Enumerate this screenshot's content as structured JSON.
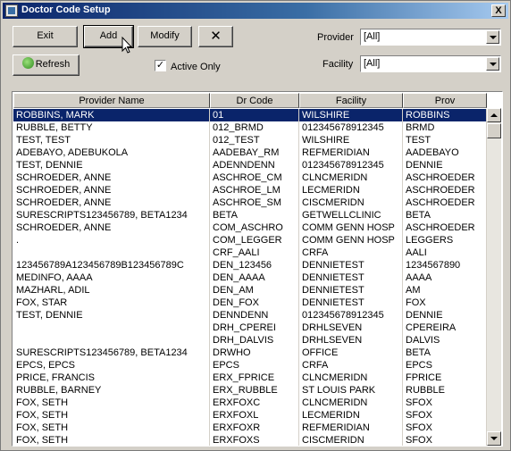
{
  "window": {
    "title": "Doctor Code Setup",
    "close_glyph": "X"
  },
  "toolbar": {
    "exit_label": "Exit",
    "add_label": "Add",
    "modify_label": "Modify",
    "delete_glyph": "✕",
    "refresh_label": "Refresh",
    "active_only_label": "Active Only",
    "active_only_checked": "✓"
  },
  "filters": {
    "provider_label": "Provider",
    "provider_value": "[All]",
    "facility_label": "Facility",
    "facility_value": "[All]"
  },
  "grid": {
    "columns": [
      "Provider Name",
      "Dr Code",
      "Facility",
      "Prov"
    ],
    "selected_row": 0,
    "rows": [
      [
        "ROBBINS, MARK",
        "01",
        "WILSHIRE",
        "ROBBINS"
      ],
      [
        "RUBBLE, BETTY",
        "012_BRMD",
        "012345678912345",
        "BRMD"
      ],
      [
        "TEST, TEST",
        "012_TEST",
        "WILSHIRE",
        "TEST"
      ],
      [
        "ADEBAYO, ADEBUKOLA",
        "AADEBAY_RM",
        "REFMERIDIAN",
        "AADEBAYO"
      ],
      [
        "TEST, DENNIE",
        "ADENNDENN",
        "012345678912345",
        "DENNIE"
      ],
      [
        "SCHROEDER, ANNE",
        "ASCHROE_CM",
        "CLNCMERIDN",
        "ASCHROEDER"
      ],
      [
        "SCHROEDER, ANNE",
        "ASCHROE_LM",
        "LECMERIDN",
        "ASCHROEDER"
      ],
      [
        "SCHROEDER, ANNE",
        "ASCHROE_SM",
        "CISCMERIDN",
        "ASCHROEDER"
      ],
      [
        "SURESCRIPTS123456789, BETA1234",
        "BETA",
        "GETWELLCLINIC",
        "BETA"
      ],
      [
        "SCHROEDER, ANNE",
        "COM_ASCHRO",
        "COMM GENN HOSP",
        "ASCHROEDER"
      ],
      [
        ".",
        "COM_LEGGER",
        "COMM GENN HOSP",
        "LEGGERS"
      ],
      [
        "",
        "CRF_AALI",
        "CRFA",
        "AALI"
      ],
      [
        "123456789A123456789B123456789C",
        "DEN_123456",
        "DENNIETEST",
        "1234567890"
      ],
      [
        "MEDINFO, AAAA",
        "DEN_AAAA",
        "DENNIETEST",
        "AAAA"
      ],
      [
        "MAZHARL, ADIL",
        "DEN_AM",
        "DENNIETEST",
        "AM"
      ],
      [
        "FOX, STAR",
        "DEN_FOX",
        "DENNIETEST",
        "FOX"
      ],
      [
        "TEST, DENNIE",
        "DENNDENN",
        "012345678912345",
        "DENNIE"
      ],
      [
        "",
        "DRH_CPEREI",
        "DRHLSEVEN",
        "CPEREIRA"
      ],
      [
        "",
        "DRH_DALVIS",
        "DRHLSEVEN",
        "DALVIS"
      ],
      [
        "SURESCRIPTS123456789, BETA1234",
        "DRWHO",
        "OFFICE",
        "BETA"
      ],
      [
        "EPCS, EPCS",
        "EPCS",
        "CRFA",
        "EPCS"
      ],
      [
        "PRICE, FRANCIS",
        "ERX_FPRICE",
        "CLNCMERIDN",
        "FPRICE"
      ],
      [
        "RUBBLE, BARNEY",
        "ERX_RUBBLE",
        "ST LOUIS PARK",
        "RUBBLE"
      ],
      [
        "FOX, SETH",
        "ERXFOXC",
        "CLNCMERIDN",
        "SFOX"
      ],
      [
        "FOX, SETH",
        "ERXFOXL",
        "LECMERIDN",
        "SFOX"
      ],
      [
        "FOX, SETH",
        "ERXFOXR",
        "REFMERIDIAN",
        "SFOX"
      ],
      [
        "FOX, SETH",
        "ERXFOXS",
        "CISCMERIDN",
        "SFOX"
      ]
    ]
  }
}
